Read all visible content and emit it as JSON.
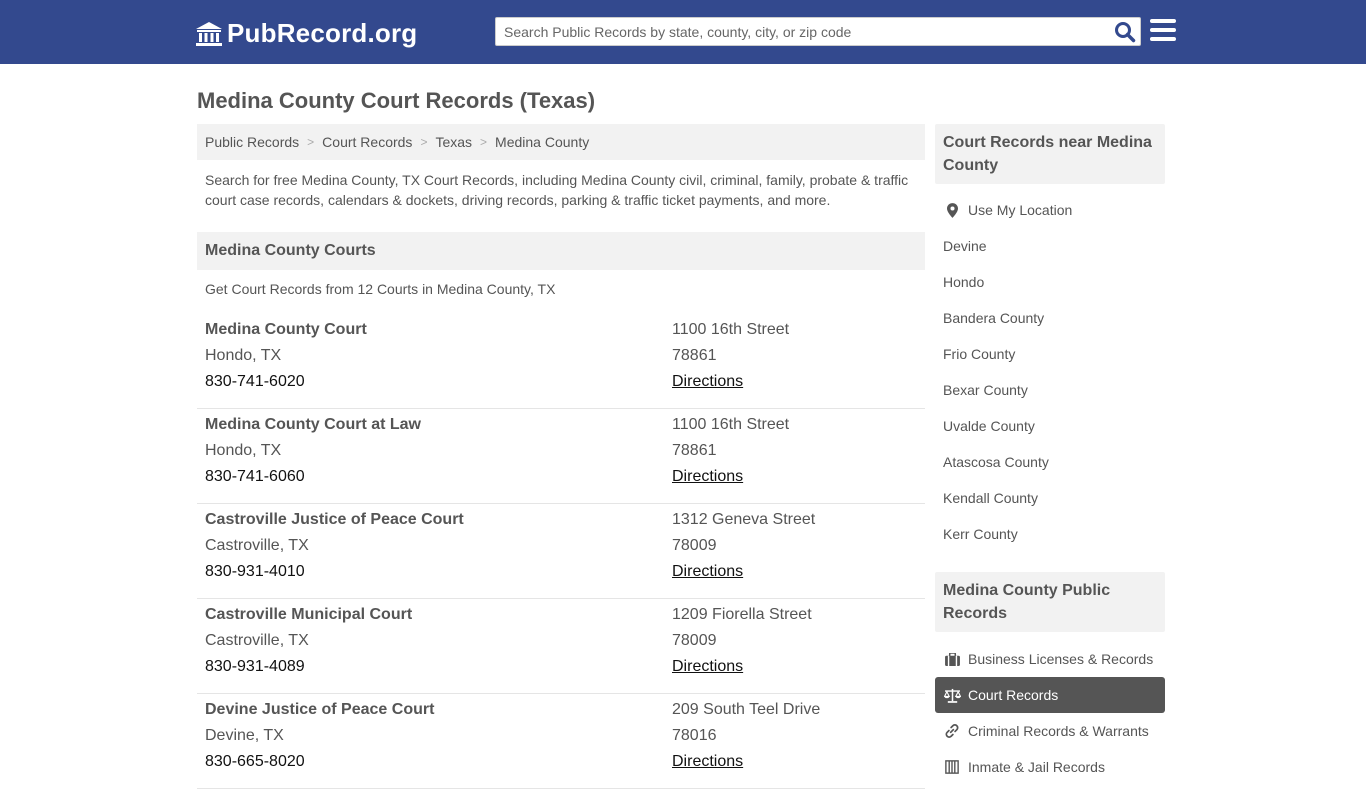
{
  "header": {
    "logo_text": "PubRecord.org",
    "search_placeholder": "Search Public Records by state, county, city, or zip code",
    "brand_color": "#33498e"
  },
  "page_title": "Medina County Court Records (Texas)",
  "breadcrumb": [
    "Public Records",
    "Court Records",
    "Texas",
    "Medina County"
  ],
  "intro": "Search for free Medina County, TX Court Records, including Medina County civil, criminal, family, probate & traffic court case records, calendars & dockets, driving records, parking & traffic ticket payments, and more.",
  "courts_section": {
    "title": "Medina County Courts",
    "subtitle": "Get Court Records from 12 Courts in Medina County, TX",
    "directions_label": "Directions",
    "items": [
      {
        "name": "Medina County Court",
        "city": "Hondo, TX",
        "phone": "830-741-6020",
        "address": "1100 16th Street",
        "zip": "78861"
      },
      {
        "name": "Medina County Court at Law",
        "city": "Hondo, TX",
        "phone": "830-741-6060",
        "address": "1100 16th Street",
        "zip": "78861"
      },
      {
        "name": "Castroville Justice of Peace Court",
        "city": "Castroville, TX",
        "phone": "830-931-4010",
        "address": "1312 Geneva Street",
        "zip": "78009"
      },
      {
        "name": "Castroville Municipal Court",
        "city": "Castroville, TX",
        "phone": "830-931-4089",
        "address": "1209 Fiorella Street",
        "zip": "78009"
      },
      {
        "name": "Devine Justice of Peace Court",
        "city": "Devine, TX",
        "phone": "830-665-8020",
        "address": "209 South Teel Drive",
        "zip": "78016"
      }
    ]
  },
  "sidebar": {
    "near_title": "Court Records near Medina County",
    "near_items": [
      "Use My Location",
      "Devine",
      "Hondo",
      "Bandera County",
      "Frio County",
      "Bexar County",
      "Uvalde County",
      "Atascosa County",
      "Kendall County",
      "Kerr County"
    ],
    "public_title": "Medina County Public Records",
    "public_items": [
      {
        "label": "Business Licenses & Records",
        "icon": "briefcase-icon"
      },
      {
        "label": "Court Records",
        "icon": "scales-icon",
        "active": true
      },
      {
        "label": "Criminal Records & Warrants",
        "icon": "link-icon"
      },
      {
        "label": "Inmate & Jail Records",
        "icon": "jail-icon"
      }
    ]
  }
}
